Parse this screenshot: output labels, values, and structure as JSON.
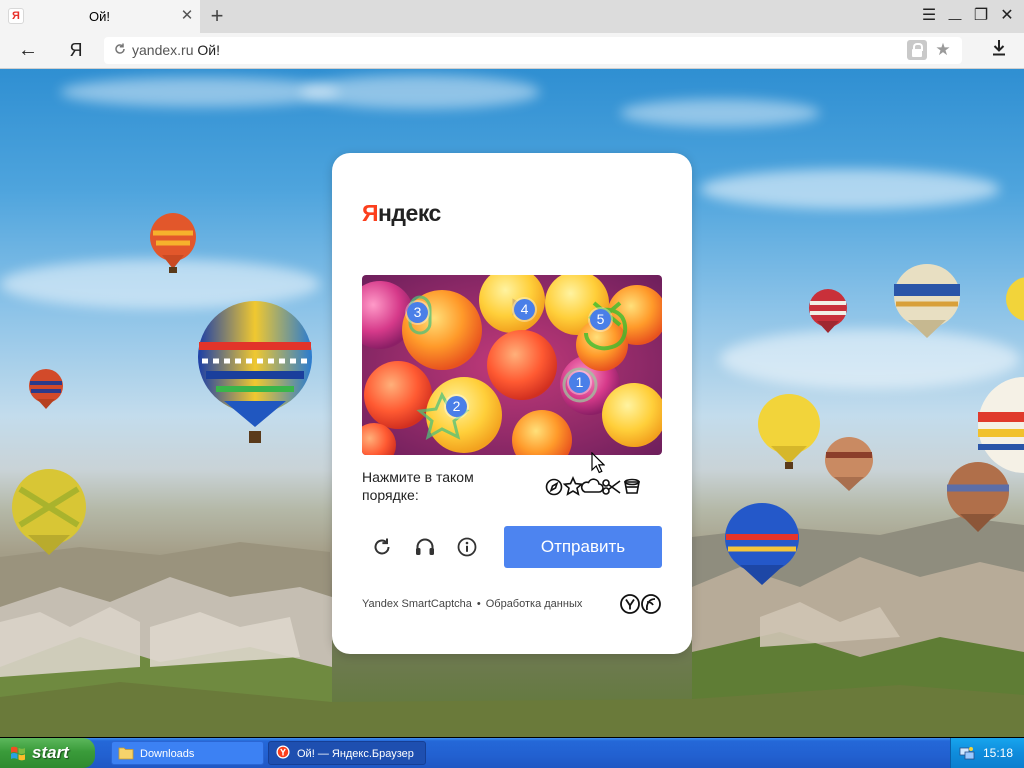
{
  "browser": {
    "tab_title": "Ой!",
    "favicon_letter": "Я",
    "tab_close": "✕",
    "new_tab": "+",
    "window_controls": {
      "menu": "☰",
      "minimize": "—",
      "restore": "❐",
      "close": "✕"
    },
    "back": "←",
    "ya_button": "Я",
    "address": {
      "host": "yandex.ru",
      "title": "Ой!"
    },
    "icons": [
      "lock-icon",
      "star-icon",
      "download-icon",
      "reload-icon"
    ]
  },
  "captcha": {
    "logo_first_letter": "Я",
    "logo_rest": "ндекс",
    "prompt": "Нажмите в таком порядке:",
    "markers": [
      "1",
      "2",
      "3",
      "4",
      "5"
    ],
    "submit_label": "Отправить",
    "footer_brand": "Yandex SmartCaptcha",
    "footer_separator": "•",
    "footer_link": "Обработка данных",
    "tool_icons": [
      "refresh-icon",
      "headphones-icon",
      "info-icon"
    ]
  },
  "taskbar": {
    "start_label": "start",
    "items": [
      {
        "label": "Downloads",
        "icon": "folder-icon",
        "active": false
      },
      {
        "label": "Ой! — Яндекс.Браузер",
        "icon": "yandex-browser-icon",
        "active": true
      }
    ],
    "clock": "15:18"
  },
  "colors": {
    "accent": "#4d84f0",
    "yandex_red": "#fc3f1d",
    "marker_blue": "#4a7fe8",
    "taskbar_blue": "#2260d0",
    "start_green": "#3a9b3a"
  }
}
